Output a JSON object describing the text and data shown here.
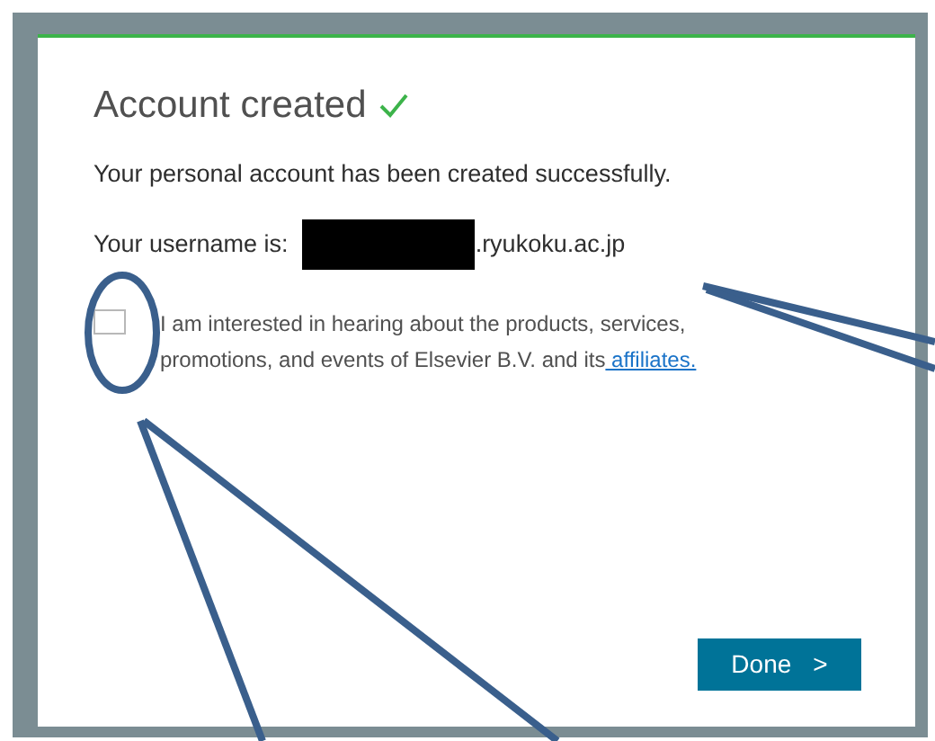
{
  "dialog": {
    "title": "Account created",
    "message": "Your personal account has been created successfully.",
    "username_label": "Your username is:",
    "username_suffix": ".ryukoku.ac.jp",
    "consent": {
      "checked": false,
      "text": "I am interested in hearing about the products, services, promotions, and events of Elsevier B.V. and its",
      "link": " affiliates."
    },
    "button": {
      "label": "Done",
      "icon": ">"
    }
  }
}
